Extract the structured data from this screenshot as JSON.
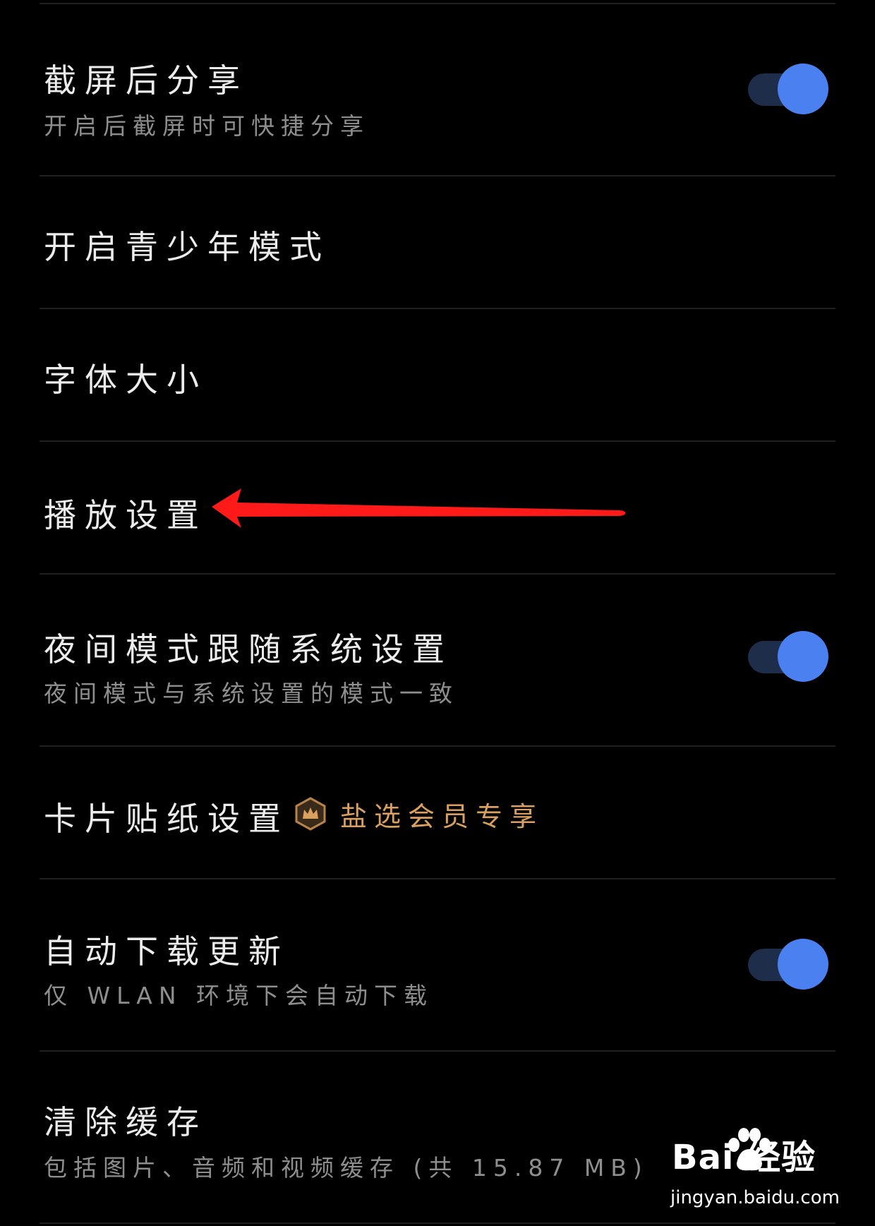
{
  "settings": {
    "screenshot_share": {
      "title": "截屏后分享",
      "subtitle": "开启后截屏时可快捷分享",
      "enabled": true
    },
    "teen_mode": {
      "title": "开启青少年模式"
    },
    "font_size": {
      "title": "字体大小"
    },
    "playback": {
      "title": "播放设置"
    },
    "night_mode": {
      "title": "夜间模式跟随系统设置",
      "subtitle": "夜间模式与系统设置的模式一致",
      "enabled": true
    },
    "card_stickers": {
      "title": "卡片贴纸设置",
      "badge_label": "盐选会员专享",
      "badge_icon": "crown-icon"
    },
    "auto_update": {
      "title": "自动下载更新",
      "subtitle": "仅 WLAN 环境下会自动下载",
      "enabled": true
    },
    "clear_cache": {
      "title": "清除缓存",
      "subtitle": "包括图片、音频和视频缓存 (共 15.87 MB)"
    }
  },
  "annotation": {
    "arrow_icon": "red-arrow-pointing-left",
    "color": "#ff1a1a"
  },
  "watermark": {
    "logo": "Bai  经验",
    "url": "jingyan.baidu.com"
  },
  "colors": {
    "background": "#000000",
    "toggle_on": "#4a80f0",
    "toggle_track": "#1d2d4a",
    "badge": "#d9a060"
  }
}
